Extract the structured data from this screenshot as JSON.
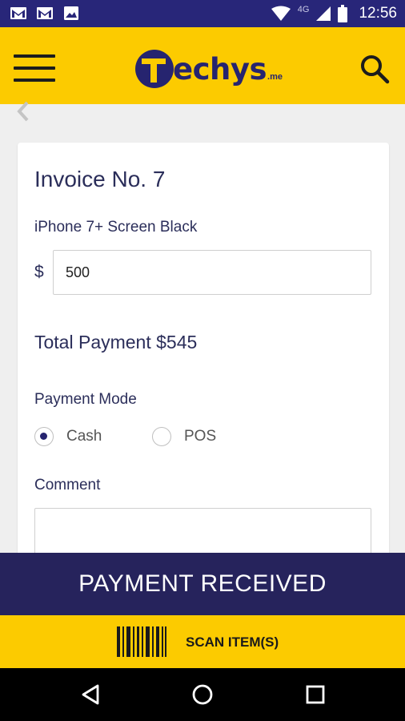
{
  "status_bar": {
    "network": "4G",
    "time": "12:56",
    "icons": [
      "gmail-icon",
      "gmail-icon",
      "image-icon",
      "wifi-icon",
      "signal-icon",
      "battery-icon"
    ]
  },
  "app_bar": {
    "logo_text": "echys",
    "logo_tld": ".me"
  },
  "invoice": {
    "title": "Invoice No. 7",
    "product": "iPhone 7+ Screen Black",
    "currency": "$",
    "amount": "500",
    "total": "Total Payment $545",
    "payment_mode_label": "Payment Mode",
    "options": [
      {
        "label": "Cash",
        "selected": true
      },
      {
        "label": "POS",
        "selected": false
      }
    ],
    "comment_label": "Comment",
    "comment_value": ""
  },
  "actions": {
    "payment_received": "PAYMENT RECEIVED",
    "scan_items": "SCAN ITEM(S)"
  },
  "colors": {
    "brand_yellow": "#fccb00",
    "brand_navy": "#26235c",
    "status_bar": "#282679"
  }
}
